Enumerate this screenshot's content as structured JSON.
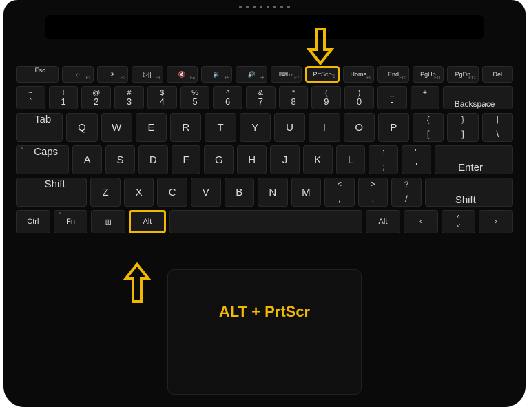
{
  "caption": "ALT + PrtScr",
  "highlight_color": "#f0b800",
  "fnRow": [
    {
      "main": "Esc",
      "sub": ""
    },
    {
      "main": "☼",
      "sub": "F1"
    },
    {
      "main": "☀",
      "sub": "F2"
    },
    {
      "main": "▷||",
      "sub": "F3"
    },
    {
      "main": "🔇",
      "sub": "F4"
    },
    {
      "main": "🔉",
      "sub": "F5"
    },
    {
      "main": "🔊",
      "sub": "F6"
    },
    {
      "main": "⌨☼",
      "sub": "F7"
    },
    {
      "main": "PrtScn",
      "sub": "F8",
      "hl": true
    },
    {
      "main": "Home",
      "sub": "F9"
    },
    {
      "main": "End",
      "sub": "F10"
    },
    {
      "main": "PgUp",
      "sub": "F11"
    },
    {
      "main": "PgDn",
      "sub": "F12"
    },
    {
      "main": "Del",
      "sub": ""
    }
  ],
  "numRow": [
    {
      "top": "~",
      "bot": "`"
    },
    {
      "top": "!",
      "bot": "1"
    },
    {
      "top": "@",
      "bot": "2"
    },
    {
      "top": "#",
      "bot": "3"
    },
    {
      "top": "$",
      "bot": "4"
    },
    {
      "top": "%",
      "bot": "5"
    },
    {
      "top": "^",
      "bot": "6"
    },
    {
      "top": "&",
      "bot": "7"
    },
    {
      "top": "*",
      "bot": "8"
    },
    {
      "top": "(",
      "bot": "9"
    },
    {
      "top": ")",
      "bot": "0"
    },
    {
      "top": "_",
      "bot": "-"
    },
    {
      "top": "+",
      "bot": "="
    }
  ],
  "backspace": "Backspace",
  "tab": "Tab",
  "row3": [
    "Q",
    "W",
    "E",
    "R",
    "T",
    "Y",
    "U",
    "I",
    "O",
    "P"
  ],
  "row3end": [
    {
      "top": "{",
      "bot": "["
    },
    {
      "top": "}",
      "bot": "]"
    },
    {
      "top": "|",
      "bot": "\\"
    }
  ],
  "caps": "Caps",
  "row4": [
    "A",
    "S",
    "D",
    "F",
    "G",
    "H",
    "J",
    "K",
    "L"
  ],
  "row4end": [
    {
      "top": ":",
      "bot": ";"
    },
    {
      "top": "\"",
      "bot": "'"
    }
  ],
  "enter": "Enter",
  "shift": "Shift",
  "row5": [
    "Z",
    "X",
    "C",
    "V",
    "B",
    "N",
    "M"
  ],
  "row5end": [
    {
      "top": "<",
      "bot": ","
    },
    {
      "top": ">",
      "bot": "."
    },
    {
      "top": "?",
      "bot": "/"
    }
  ],
  "row6": {
    "ctrl": "Ctrl",
    "fn": "Fn",
    "win": "⊞",
    "altL": "Alt",
    "altR": "Alt",
    "left": "‹",
    "up": "˄",
    "down": "˅",
    "right": "›"
  }
}
